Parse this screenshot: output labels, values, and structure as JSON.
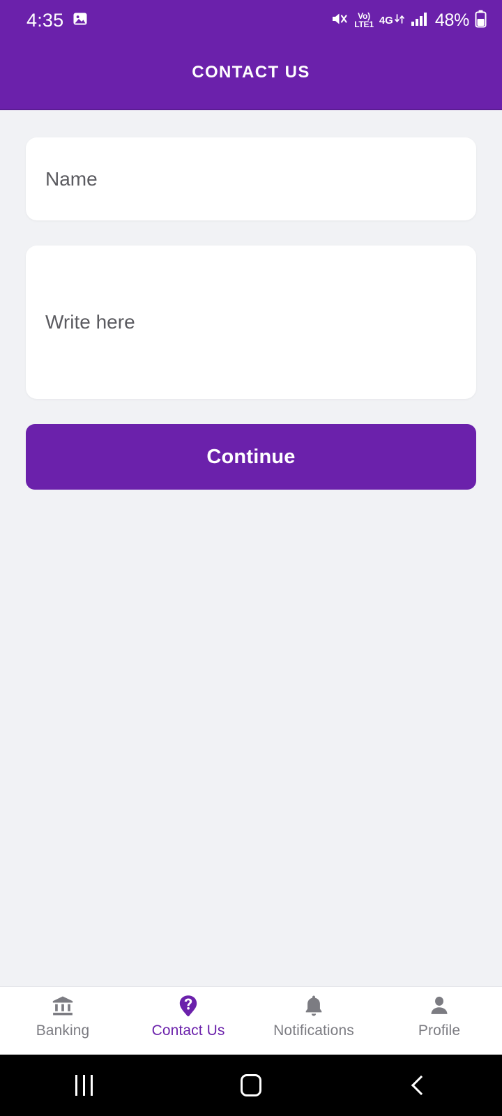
{
  "status_bar": {
    "time": "4:35",
    "photo_icon": "image-icon",
    "mute_icon": "mute-icon",
    "volte_line1": "Vo)",
    "volte_line2": "LTE1",
    "network_type": "4G",
    "data_arrows_icon": "data-transfer-icon",
    "signal_icon": "signal-bars-icon",
    "battery_percent": "48%",
    "battery_icon": "battery-icon"
  },
  "header": {
    "title": "CONTACT US",
    "background_color": "#6B21AB",
    "text_color": "#FFFFFF"
  },
  "form": {
    "name_field": {
      "value": "",
      "placeholder": "Name"
    },
    "message_field": {
      "value": "",
      "placeholder": "Write here"
    },
    "submit_label": "Continue"
  },
  "bottom_nav": {
    "active_index": 1,
    "accent_color": "#6B21AB",
    "inactive_color": "#7C7C82",
    "items": [
      {
        "label": "Banking",
        "icon": "bank-icon"
      },
      {
        "label": "Contact Us",
        "icon": "help-pin-icon"
      },
      {
        "label": "Notifications",
        "icon": "bell-icon"
      },
      {
        "label": "Profile",
        "icon": "person-icon"
      }
    ]
  },
  "android_nav": {
    "recents_label": "Recents",
    "home_label": "Home",
    "back_label": "Back"
  },
  "colors": {
    "page_background": "#F1F2F5",
    "card_background": "#FFFFFF",
    "primary": "#6B21AB",
    "placeholder_text": "#5B5B60"
  }
}
